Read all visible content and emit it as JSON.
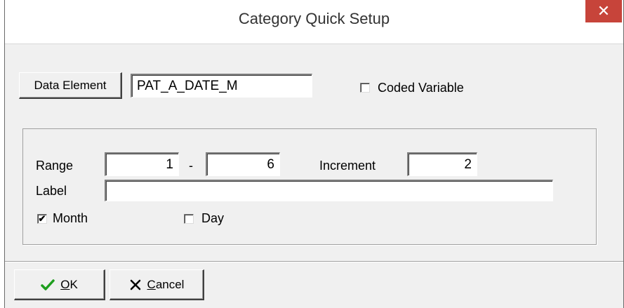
{
  "window": {
    "title": "Category Quick Setup",
    "close_symbol": "✕"
  },
  "data_element": {
    "button_label": "Data Element",
    "value": "PAT_A_DATE_M"
  },
  "coded_variable": {
    "label": "Coded Variable",
    "checked": false
  },
  "range": {
    "label": "Range",
    "from": "1",
    "separator": "-",
    "to": "6"
  },
  "increment": {
    "label": "Increment",
    "value": "2"
  },
  "label_field": {
    "label": "Label",
    "value": ""
  },
  "month": {
    "label": "Month",
    "checked": true,
    "check_mark": "✔"
  },
  "day": {
    "label": "Day",
    "checked": false
  },
  "buttons": {
    "ok": {
      "mnemonic": "O",
      "rest": "K"
    },
    "cancel": {
      "mnemonic": "C",
      "rest": "ancel"
    }
  },
  "colors": {
    "ok_check": "#1e9e1e",
    "close_bg": "#c7443a"
  },
  "icons": {
    "ok": "checkmark-icon",
    "cancel": "x-icon",
    "close": "close-icon"
  }
}
